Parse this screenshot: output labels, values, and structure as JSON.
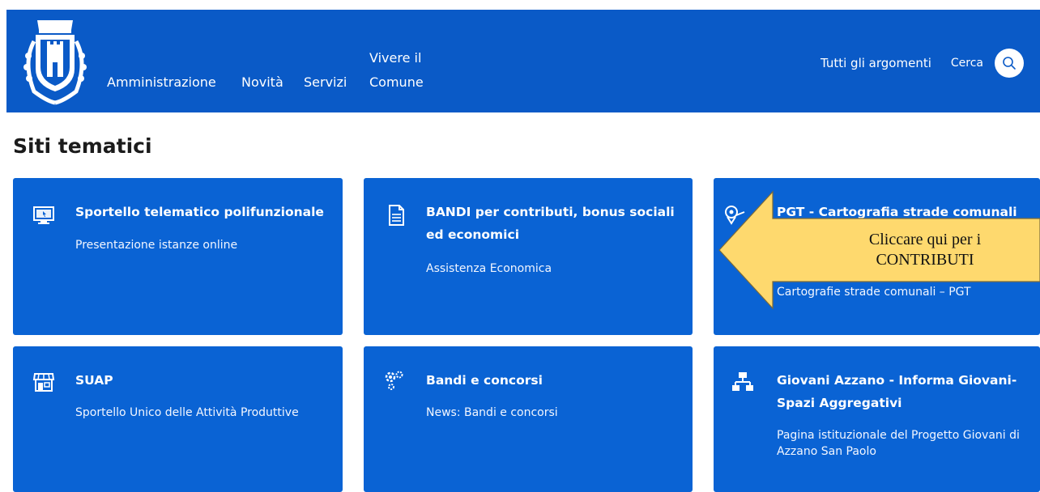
{
  "header": {
    "nav": [
      {
        "label": "Amministrazione"
      },
      {
        "label": "Novità"
      },
      {
        "label": "Servizi"
      },
      {
        "label_line1": "Vivere il",
        "label_line2": "Comune"
      }
    ],
    "topics_label": "Tutti gli argomenti",
    "search_label": "Cerca"
  },
  "section_title": "Siti tematici",
  "cards": [
    {
      "title": "Sportello telematico polifunzionale",
      "subtitle": "Presentazione istanze online",
      "icon": "computer-icon"
    },
    {
      "title": "BANDI per contributi, bonus sociali ed economici",
      "subtitle": "Assistenza Economica",
      "icon": "document-icon"
    },
    {
      "title": "PGT - Cartografia strade comunali",
      "subtitle": "Cartografie strade comunali – PGT",
      "icon": "map-pin-icon"
    },
    {
      "title": "SUAP",
      "subtitle": "Sportello Unico delle Attività Produttive",
      "icon": "shop-icon"
    },
    {
      "title": "Bandi e concorsi",
      "subtitle": "News: Bandi e concorsi",
      "icon": "gears-icon"
    },
    {
      "title": "Giovani Azzano - Informa Giovani-Spazi Aggregativi",
      "subtitle": "Pagina istituzionale del Progetto Giovani di Azzano San Paolo",
      "icon": "network-icon"
    }
  ],
  "callout": {
    "line1": "Cliccare qui per i",
    "line2": "CONTRIBUTI"
  },
  "colors": {
    "header": "#0a5ac7",
    "card": "#0a63d4",
    "callout": "#fed96e"
  }
}
